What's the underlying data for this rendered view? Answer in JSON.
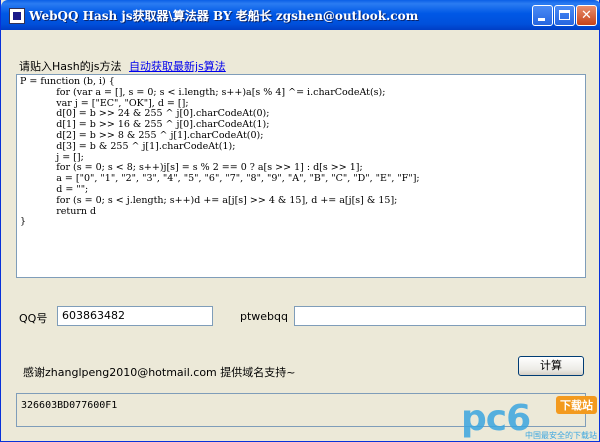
{
  "window": {
    "title": "WebQQ Hash js获取器\\算法器   BY 老船长 zgshen@outlook.com"
  },
  "labels": {
    "paste_hint": "请贴入Hash的js方法",
    "auto_fetch_link": "自动获取最新js算法",
    "qq_label": "QQ号",
    "ptwebqq_label": "ptwebqq",
    "thanks": "感谢zhanglpeng2010@hotmail.com 提供域名支持~",
    "compute_button": "计算"
  },
  "code": "P = function (b, i) {\n            for (var a = [], s = 0; s < i.length; s++)a[s % 4] ^= i.charCodeAt(s);\n            var j = [\"EC\", \"OK\"], d = [];\n            d[0] = b >> 24 & 255 ^ j[0].charCodeAt(0);\n            d[1] = b >> 16 & 255 ^ j[0].charCodeAt(1);\n            d[2] = b >> 8 & 255 ^ j[1].charCodeAt(0);\n            d[3] = b & 255 ^ j[1].charCodeAt(1);\n            j = [];\n            for (s = 0; s < 8; s++)j[s] = s % 2 == 0 ? a[s >> 1] : d[s >> 1];\n            a = [\"0\", \"1\", \"2\", \"3\", \"4\", \"5\", \"6\", \"7\", \"8\", \"9\", \"A\", \"B\", \"C\", \"D\", \"E\", \"F\"];\n            d = \"\";\n            for (s = 0; s < j.length; s++)d += a[j[s] >> 4 & 15], d += a[j[s] & 15];\n            return d\n}",
  "fields": {
    "qq_value": "603863482",
    "ptwebqq_value": ""
  },
  "output": "326603BD077600F1",
  "watermark": {
    "logo": "pc6",
    "badge": "下载站",
    "sub": "中国最安全的下载站"
  },
  "colors": {
    "titlebar": "#0058E6",
    "window_bg": "#ECE9D8",
    "link": "#0000EE",
    "close_button": "#C6431A"
  }
}
